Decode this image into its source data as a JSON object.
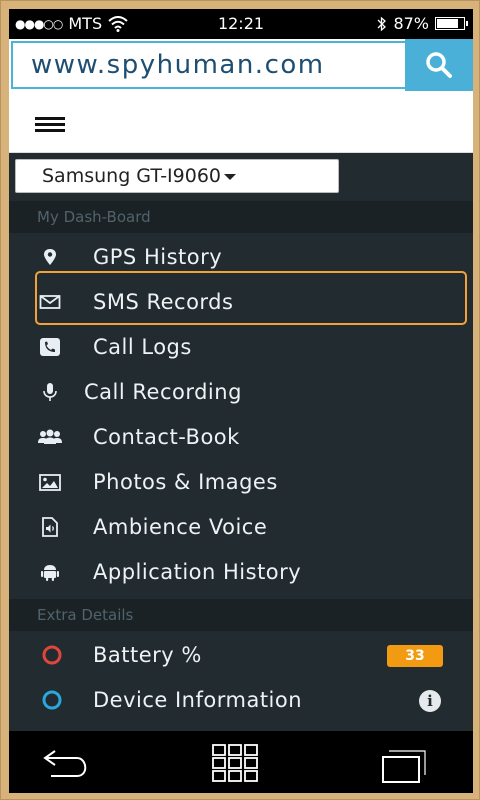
{
  "status": {
    "signal": "●●●○○",
    "carrier": "MTS",
    "time": "12:21",
    "battery_text": "87%",
    "battery_level": 0.87
  },
  "browser": {
    "url": "www.spyhuman.com"
  },
  "device_select": {
    "selected": "Samsung GT-I9060"
  },
  "sections": [
    {
      "label": "My Dash-Board"
    },
    {
      "label": "Extra Details"
    }
  ],
  "menu": [
    {
      "label": "GPS History",
      "icon": "location-pin-icon"
    },
    {
      "label": "SMS Records",
      "icon": "envelope-icon"
    },
    {
      "label": "Call Logs",
      "icon": "phone-icon"
    },
    {
      "label": "Call Recording",
      "icon": "microphone-icon"
    },
    {
      "label": "Contact-Book",
      "icon": "users-icon"
    },
    {
      "label": "Photos & Images",
      "icon": "image-icon"
    },
    {
      "label": "Ambience Voice",
      "icon": "audio-file-icon"
    },
    {
      "label": "Application History",
      "icon": "android-icon"
    }
  ],
  "extra": [
    {
      "label": "Battery %",
      "badge": "33",
      "icon": "circle-red-icon"
    },
    {
      "label": "Device Information",
      "icon": "circle-blue-icon"
    }
  ],
  "colors": {
    "accent": "#4bb0d8",
    "sidebar_bg": "#222b30",
    "highlight": "#f4a13a",
    "badge": "#f29b12"
  }
}
